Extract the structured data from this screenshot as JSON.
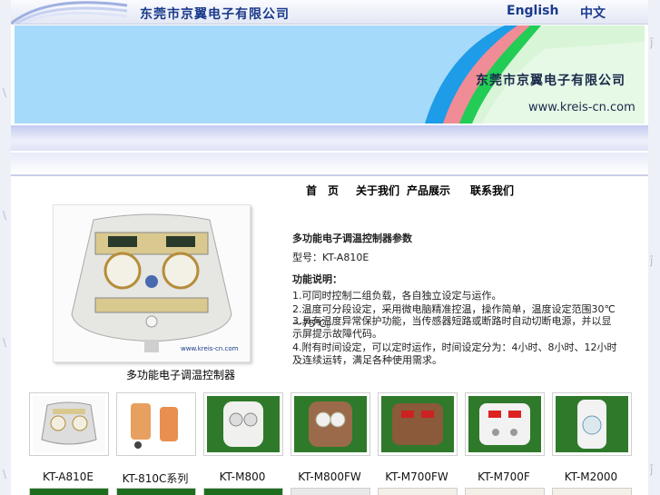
{
  "header": {
    "company": "东莞市京翼电子有限公司",
    "lang_en": "English",
    "lang_cn": "中文"
  },
  "banner": {
    "company": "东莞市京翼电子有限公司",
    "url": "www.kreis-cn.com"
  },
  "nav": [
    "首　页",
    "关于我们",
    "产品展示",
    "联系我们"
  ],
  "product": {
    "caption": "多功能电子调温控制器",
    "photo_url": "www.kreis-cn.com",
    "heading": "多功能电子调温控制器参数",
    "model": "型号：KT-A810E",
    "features_title": "功能说明：",
    "features": [
      "1.可同时控制二组负载，各自独立设定与运作。",
      "2.温度可分段设定，采用微电脑精准控温，操作简单，温度设定范围30℃～75℃。",
      "3.具有温度异常保护功能，当传感器短路或断路时自动切断电源，并以显示屏提示故障代码。",
      "4.附有时间设定，可以定时运作，时间设定分为：4小时、8小时、12小时及连续运转，满足各种使用需求。"
    ]
  },
  "thumbnails": [
    {
      "label": "KT-A810E"
    },
    {
      "label": "KT-810C系列"
    },
    {
      "label": "KT-M800"
    },
    {
      "label": "KT-M800FW"
    },
    {
      "label": "KT-M700FW"
    },
    {
      "label": "KT-M700F"
    },
    {
      "label": "KT-M2000"
    }
  ],
  "colors": {
    "banner_sky": "#a6dafa",
    "swoosh_blue": "#1e9ce8",
    "swoosh_pink": "#f08c96",
    "swoosh_green": "#22cc55",
    "band": "#c4cbf0"
  }
}
